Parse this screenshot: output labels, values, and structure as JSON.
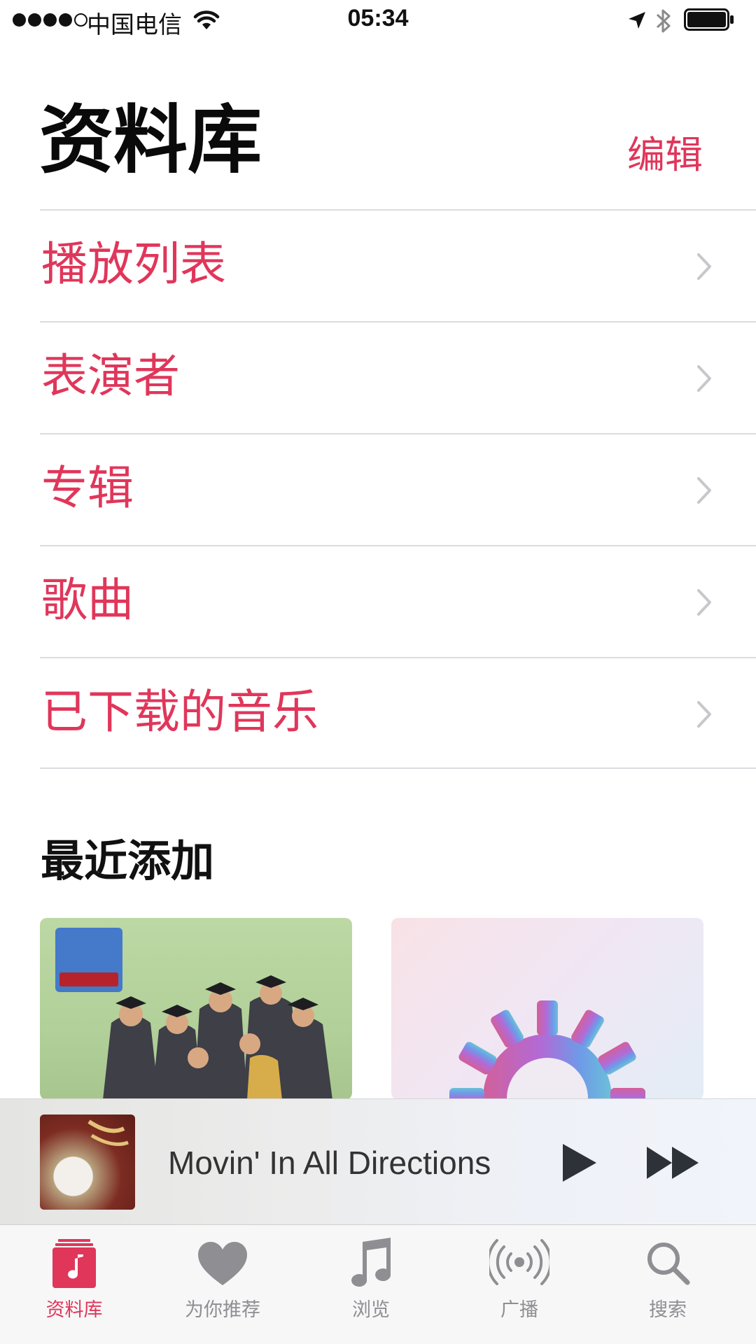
{
  "status_bar": {
    "carrier": "中国电信",
    "time": "05:34"
  },
  "header": {
    "title": "资料库",
    "edit_label": "编辑"
  },
  "library": {
    "items": [
      {
        "label": "播放列表"
      },
      {
        "label": "表演者"
      },
      {
        "label": "专辑"
      },
      {
        "label": "歌曲"
      },
      {
        "label": "已下载的音乐"
      }
    ]
  },
  "recently_added": {
    "title": "最近添加"
  },
  "now_playing": {
    "title": "Movin' In All Directions"
  },
  "tabs": [
    {
      "label": "资料库",
      "icon": "library-icon",
      "active": true
    },
    {
      "label": "为你推荐",
      "icon": "heart-icon",
      "active": false
    },
    {
      "label": "浏览",
      "icon": "music-note-icon",
      "active": false
    },
    {
      "label": "广播",
      "icon": "radio-icon",
      "active": false
    },
    {
      "label": "搜索",
      "icon": "search-icon",
      "active": false
    }
  ],
  "colors": {
    "accent": "#e0365a",
    "tab_inactive": "#8e8e93"
  }
}
